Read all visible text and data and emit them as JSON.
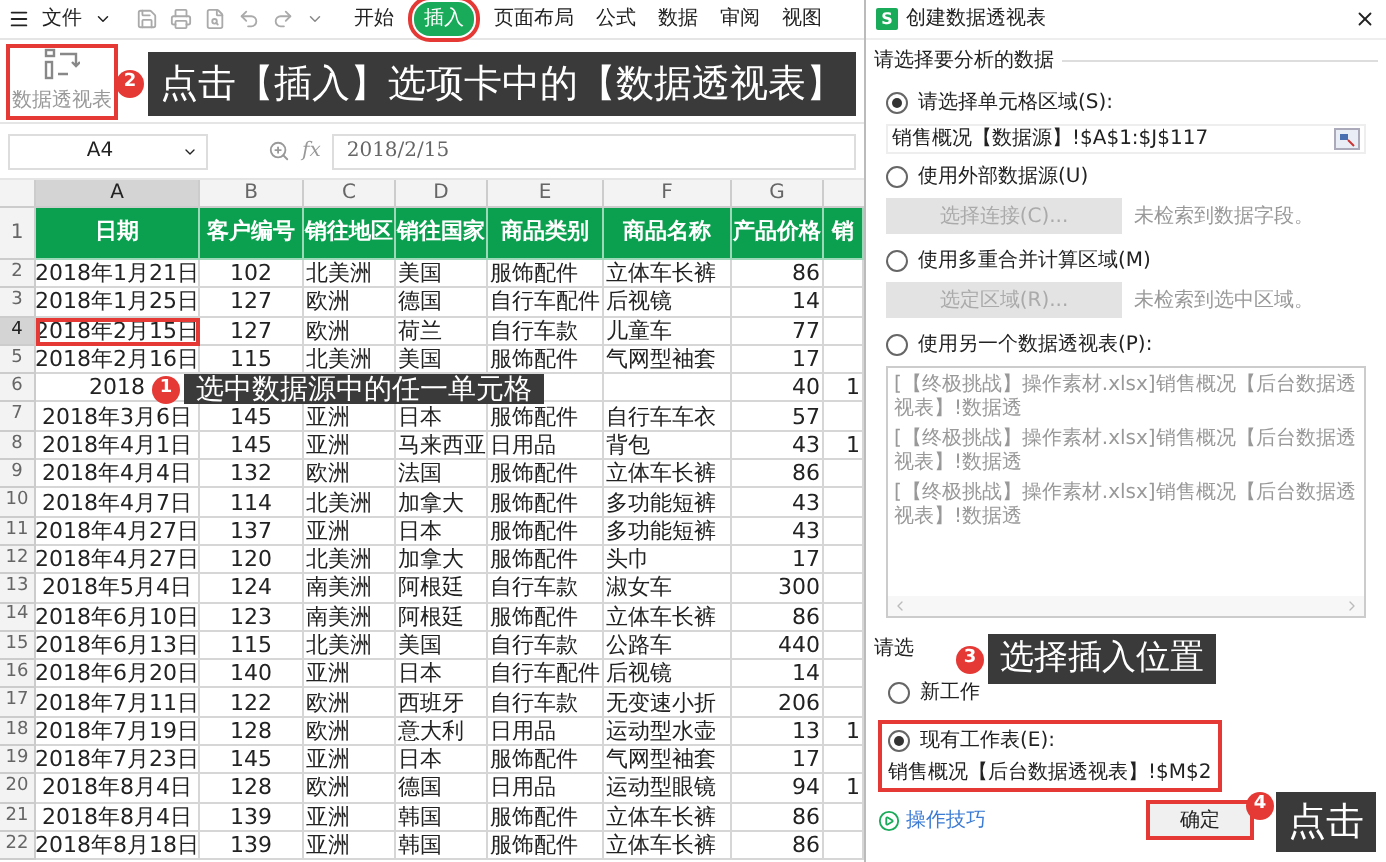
{
  "menu": {
    "file": "文件",
    "tabs": [
      {
        "label": "开始",
        "selected": false
      },
      {
        "label": "插入",
        "selected": true
      },
      {
        "label": "页面布局",
        "selected": false
      },
      {
        "label": "公式",
        "selected": false
      },
      {
        "label": "数据",
        "selected": false
      },
      {
        "label": "审阅",
        "selected": false
      },
      {
        "label": "视图",
        "selected": false
      }
    ]
  },
  "ribbon": {
    "button": "数据透视表",
    "highlighted": true
  },
  "formula_bar": {
    "name_box": "A4",
    "fx": "fx",
    "formula": "2018/2/15"
  },
  "sheet": {
    "columns": [
      {
        "label": "A",
        "selected": true
      },
      {
        "label": "B",
        "selected": false
      },
      {
        "label": "C",
        "selected": false
      },
      {
        "label": "D",
        "selected": false
      },
      {
        "label": "E",
        "selected": false
      },
      {
        "label": "F",
        "selected": false
      },
      {
        "label": "G",
        "selected": false
      }
    ],
    "header_row": {
      "n": "1",
      "cells": [
        "日期",
        "客户编号",
        "销往地区",
        "销往国家",
        "商品类别",
        "商品名称",
        "产品价格",
        "销"
      ]
    },
    "rows": [
      {
        "n": "2",
        "selected": false,
        "cells": {
          "A": "2018年1月21日",
          "B": "102",
          "C": "北美洲",
          "D": "美国",
          "E": "服饰配件",
          "F": "立体车长裤",
          "G": "86"
        }
      },
      {
        "n": "3",
        "selected": false,
        "cells": {
          "A": "2018年1月25日",
          "B": "127",
          "C": "欧洲",
          "D": "德国",
          "E": "自行车配件",
          "F": "后视镜",
          "G": "14"
        }
      },
      {
        "n": "4",
        "selected": true,
        "cells": {
          "A": "2018年2月15日",
          "B": "127",
          "C": "欧洲",
          "D": "荷兰",
          "E": "自行车款",
          "F": "儿童车",
          "G": "77"
        }
      },
      {
        "n": "5",
        "selected": false,
        "cells": {
          "A": "2018年2月16日",
          "B": "115",
          "C": "北美洲",
          "D": "美国",
          "E": "服饰配件",
          "F": "气网型袖套",
          "G": "17"
        }
      },
      {
        "n": "6",
        "selected": false,
        "cells": {
          "A": "2018",
          "G": "40",
          "H": "1"
        }
      },
      {
        "n": "7",
        "selected": false,
        "cells": {
          "A": "2018年3月6日",
          "B": "145",
          "C": "亚洲",
          "D": "日本",
          "E": "服饰配件",
          "F": "自行车车衣",
          "G": "57"
        }
      },
      {
        "n": "8",
        "selected": false,
        "cells": {
          "A": "2018年4月1日",
          "B": "145",
          "C": "亚洲",
          "D": "马来西亚",
          "E": "日用品",
          "F": "背包",
          "G": "43",
          "H": "1"
        }
      },
      {
        "n": "9",
        "selected": false,
        "cells": {
          "A": "2018年4月4日",
          "B": "132",
          "C": "欧洲",
          "D": "法国",
          "E": "服饰配件",
          "F": "立体车长裤",
          "G": "86"
        }
      },
      {
        "n": "10",
        "selected": false,
        "cells": {
          "A": "2018年4月7日",
          "B": "114",
          "C": "北美洲",
          "D": "加拿大",
          "E": "服饰配件",
          "F": "多功能短裤",
          "G": "43"
        }
      },
      {
        "n": "11",
        "selected": false,
        "cells": {
          "A": "2018年4月27日",
          "B": "137",
          "C": "亚洲",
          "D": "日本",
          "E": "服饰配件",
          "F": "多功能短裤",
          "G": "43"
        }
      },
      {
        "n": "12",
        "selected": false,
        "cells": {
          "A": "2018年4月27日",
          "B": "120",
          "C": "北美洲",
          "D": "加拿大",
          "E": "服饰配件",
          "F": "头巾",
          "G": "17"
        }
      },
      {
        "n": "13",
        "selected": false,
        "cells": {
          "A": "2018年5月4日",
          "B": "124",
          "C": "南美洲",
          "D": "阿根廷",
          "E": "自行车款",
          "F": "淑女车",
          "G": "300"
        }
      },
      {
        "n": "14",
        "selected": false,
        "cells": {
          "A": "2018年6月10日",
          "B": "123",
          "C": "南美洲",
          "D": "阿根廷",
          "E": "服饰配件",
          "F": "立体车长裤",
          "G": "86"
        }
      },
      {
        "n": "15",
        "selected": false,
        "cells": {
          "A": "2018年6月13日",
          "B": "115",
          "C": "北美洲",
          "D": "美国",
          "E": "自行车款",
          "F": "公路车",
          "G": "440"
        }
      },
      {
        "n": "16",
        "selected": false,
        "cells": {
          "A": "2018年6月20日",
          "B": "140",
          "C": "亚洲",
          "D": "日本",
          "E": "自行车配件",
          "F": "后视镜",
          "G": "14"
        }
      },
      {
        "n": "17",
        "selected": false,
        "cells": {
          "A": "2018年7月11日",
          "B": "122",
          "C": "欧洲",
          "D": "西班牙",
          "E": "自行车款",
          "F": "无变速小折",
          "G": "206"
        }
      },
      {
        "n": "18",
        "selected": false,
        "cells": {
          "A": "2018年7月19日",
          "B": "128",
          "C": "欧洲",
          "D": "意大利",
          "E": "日用品",
          "F": "运动型水壶",
          "G": "13",
          "H": "1"
        }
      },
      {
        "n": "19",
        "selected": false,
        "cells": {
          "A": "2018年7月23日",
          "B": "145",
          "C": "亚洲",
          "D": "日本",
          "E": "服饰配件",
          "F": "气网型袖套",
          "G": "17"
        }
      },
      {
        "n": "20",
        "selected": false,
        "cells": {
          "A": "2018年8月4日",
          "B": "128",
          "C": "欧洲",
          "D": "德国",
          "E": "日用品",
          "F": "运动型眼镜",
          "G": "94",
          "H": "1"
        }
      },
      {
        "n": "21",
        "selected": false,
        "cells": {
          "A": "2018年8月4日",
          "B": "139",
          "C": "亚洲",
          "D": "韩国",
          "E": "服饰配件",
          "F": "立体车长裤",
          "G": "86"
        }
      },
      {
        "n": "22",
        "selected": false,
        "cells": {
          "A": "2018年8月18日",
          "B": "139",
          "C": "亚洲",
          "D": "韩国",
          "E": "服饰配件",
          "F": "立体车长裤",
          "G": "86"
        }
      }
    ]
  },
  "dialog": {
    "app_icon": "S",
    "title": "创建数据透视表",
    "source_section": "请选择要分析的数据",
    "source_options": [
      {
        "kind": "range",
        "label": "请选择单元格区域(S):",
        "selected": true,
        "value": "销售概况【数据源】!$A$1:$J$117"
      },
      {
        "kind": "button",
        "label": "使用外部数据源(U)",
        "selected": false,
        "button": "选择连接(C)...",
        "note": "未检索到数据字段。"
      },
      {
        "kind": "button",
        "label": "使用多重合并计算区域(M)",
        "selected": false,
        "button": "选定区域(R)...",
        "note": "未检索到选中区域。"
      },
      {
        "kind": "list",
        "label": "使用另一个数据透视表(P):",
        "selected": false,
        "items": [
          "[【终极挑战】操作素材.xlsx]销售概况【后台数据透视表】!数据透",
          "[【终极挑战】操作素材.xlsx]销售概况【后台数据透视表】!数据透",
          "[【终极挑战】操作素材.xlsx]销售概况【后台数据透视表】!数据透"
        ]
      }
    ],
    "place_section": "请选",
    "place_options": [
      {
        "label": "新工作",
        "selected": false,
        "highlighted": false
      },
      {
        "label": "现有工作表(E):",
        "selected": true,
        "highlighted": true,
        "value": "销售概况【后台数据透视表】!$M$2"
      }
    ],
    "tips_link": "操作技巧",
    "ok_button": "确定",
    "ok_highlighted": true
  },
  "callouts": [
    {
      "marker": "2",
      "text": "点击【插入】选项卡中的【数据透视表】"
    },
    {
      "marker": "1",
      "text": "选中数据源中的任一单元格"
    },
    {
      "marker": "3",
      "text": "选择插入位置"
    },
    {
      "marker": "4",
      "text": "点击"
    }
  ]
}
